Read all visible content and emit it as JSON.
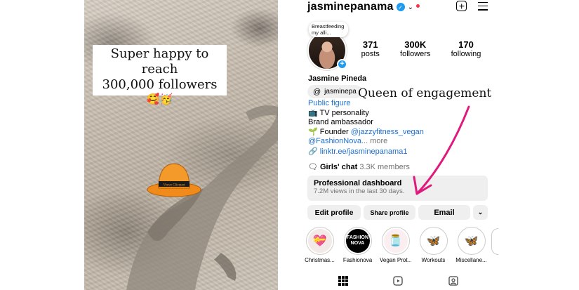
{
  "story": {
    "caption_line1": "Super happy to reach",
    "caption_line2": "300,000 followers",
    "caption_emoji": "🥰🥳",
    "hat_label": "Veuve Clicquot"
  },
  "profile": {
    "username": "jasminepanama",
    "note_text": "Breastfeeding my alli...",
    "stats": [
      {
        "num": "371",
        "label": "posts"
      },
      {
        "num": "300K",
        "label": "followers"
      },
      {
        "num": "170",
        "label": "following"
      }
    ],
    "display_name": "Jasmine Pineda",
    "threads_handle": "jasminepa",
    "bio": {
      "category": "Public figure",
      "line1": "📺 TV personality",
      "line2": "Brand ambassador",
      "line3_prefix": "🌱 Founder ",
      "line3_mention": "@jazzyfitness_vegan",
      "line4_mention": "@FashionNova",
      "line4_more": "... more"
    },
    "link": "linktr.ee/jasminepanama1",
    "chat_name": "Girls' chat",
    "chat_members": "3.3K members",
    "dashboard_title": "Professional dashboard",
    "dashboard_sub": "7.2M views in the last 30 days.",
    "buttons": {
      "edit": "Edit profile",
      "share": "Share profile",
      "email": "Email"
    },
    "highlights": [
      {
        "label": "Christmas...",
        "icon": "wreath"
      },
      {
        "label": "Fashionova",
        "icon": "fashion-nova-logo"
      },
      {
        "label": "Vegan Prot...",
        "icon": "protein-jars"
      },
      {
        "label": "Workouts",
        "icon": "butterfly"
      },
      {
        "label": "Miscellane...",
        "icon": "butterfly"
      }
    ]
  },
  "annotation": "Queen of engagement",
  "colors": {
    "verified": "#1d9bf0",
    "link": "#1d6fd1",
    "arrow": "#e0197d",
    "button_bg": "#efefef",
    "hat": "#f08a1a"
  }
}
